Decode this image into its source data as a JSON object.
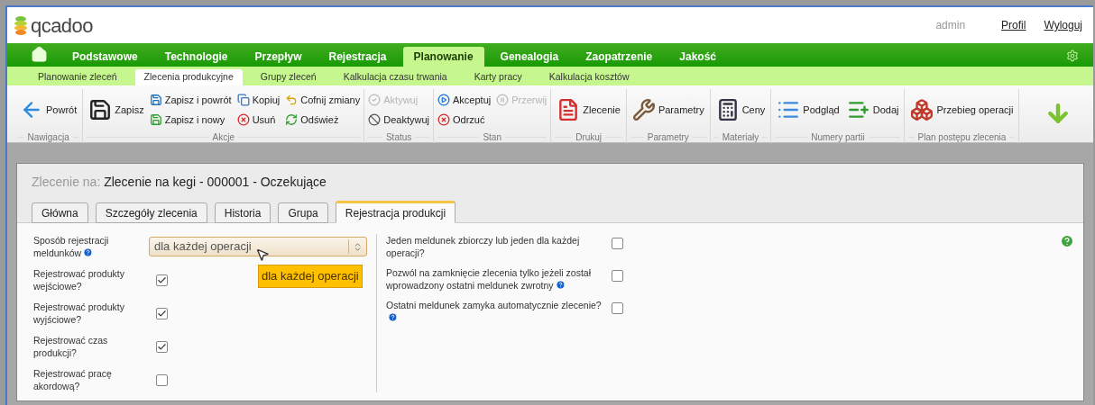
{
  "header": {
    "logo_text": "qcadoo",
    "user": "admin",
    "links": [
      "Profil",
      "Wyloguj"
    ]
  },
  "main_menu": [
    {
      "label": "Podstawowe",
      "selected": false
    },
    {
      "label": "Technologie",
      "selected": false
    },
    {
      "label": "Przepływ",
      "selected": false
    },
    {
      "label": "Rejestracja",
      "selected": false
    },
    {
      "label": "Planowanie",
      "selected": true
    },
    {
      "label": "Genealogia",
      "selected": false
    },
    {
      "label": "Zaopatrzenie",
      "selected": false
    },
    {
      "label": "Jakość",
      "selected": false
    }
  ],
  "sub_menu": [
    {
      "label": "Planowanie zleceń",
      "selected": false
    },
    {
      "label": "Zlecenia produkcyjne",
      "selected": true
    },
    {
      "label": "Grupy zleceń",
      "selected": false
    },
    {
      "label": "Kalkulacja czasu trwania",
      "selected": false
    },
    {
      "label": "Karty pracy",
      "selected": false
    },
    {
      "label": "Kalkulacja kosztów",
      "selected": false
    }
  ],
  "toolbar": [
    {
      "label": "Nawigacja",
      "buttons": [
        {
          "label": "Powrót",
          "kind": "large",
          "disabled": false
        }
      ]
    },
    {
      "label": "Akcje",
      "buttons": [
        {
          "label": "Zapisz",
          "kind": "large",
          "disabled": false
        },
        {
          "label": "Zapisz i powrót",
          "kind": "small",
          "disabled": false
        },
        {
          "label": "Zapisz i nowy",
          "kind": "small",
          "disabled": false
        },
        {
          "label": "Kopiuj",
          "kind": "small",
          "disabled": false
        },
        {
          "label": "Usuń",
          "kind": "small",
          "disabled": false
        },
        {
          "label": "Cofnij zmiany",
          "kind": "small",
          "disabled": false
        },
        {
          "label": "Odśwież",
          "kind": "small",
          "disabled": false
        }
      ]
    },
    {
      "label": "Status",
      "buttons": [
        {
          "label": "Aktywuj",
          "kind": "small",
          "disabled": true
        },
        {
          "label": "Deaktywuj",
          "kind": "small",
          "disabled": false
        }
      ]
    },
    {
      "label": "Stan",
      "buttons": [
        {
          "label": "Akceptuj",
          "kind": "small",
          "disabled": false
        },
        {
          "label": "Odrzuć",
          "kind": "small",
          "disabled": false
        },
        {
          "label": "Przerwij",
          "kind": "small",
          "disabled": true
        }
      ]
    },
    {
      "label": "Drukuj",
      "buttons": [
        {
          "label": "Zlecenie",
          "kind": "large",
          "disabled": false
        }
      ]
    },
    {
      "label": "Parametry",
      "buttons": [
        {
          "label": "Parametry",
          "kind": "large",
          "disabled": false
        }
      ]
    },
    {
      "label": "Materiały",
      "buttons": [
        {
          "label": "Ceny",
          "kind": "large",
          "disabled": false
        }
      ]
    },
    {
      "label": "Numery partii",
      "buttons": [
        {
          "label": "Podgląd",
          "kind": "large",
          "disabled": false
        },
        {
          "label": "Dodaj",
          "kind": "large",
          "disabled": false
        }
      ]
    },
    {
      "label": "Plan postępu zlecenia",
      "buttons": [
        {
          "label": "Przebieg operacji",
          "kind": "large",
          "disabled": false
        }
      ]
    }
  ],
  "form": {
    "title_prefix": "Zlecenie na:",
    "title": "Zlecenie na kegi - 000001 - Oczekujące",
    "tabs": [
      {
        "label": "Główna",
        "selected": false
      },
      {
        "label": "Szczegóły zlecenia",
        "selected": false
      },
      {
        "label": "Historia",
        "selected": false
      },
      {
        "label": "Grupa",
        "selected": false
      },
      {
        "label": "Rejestracja produkcji",
        "selected": true
      }
    ],
    "left_fields": [
      {
        "kind": "select",
        "label": "Sposób rejestracji meldunków",
        "help": true,
        "value": "dla każdej operacji"
      },
      {
        "kind": "checkbox",
        "label": "Rejestrować produkty wejściowe?",
        "checked": true
      },
      {
        "kind": "checkbox",
        "label": "Rejestrować produkty wyjściowe?",
        "checked": true
      },
      {
        "kind": "checkbox",
        "label": "Rejestrować czas produkcji?",
        "checked": true
      },
      {
        "kind": "checkbox",
        "label": "Rejestrować pracę akordową?",
        "checked": false
      }
    ],
    "tooltip": "dla każdej operacji",
    "right_fields": [
      {
        "kind": "checkbox",
        "label": "Jeden meldunek zbiorczy lub jeden dla każdej operacji?",
        "help": false,
        "checked": false
      },
      {
        "kind": "checkbox",
        "label": "Pozwól na zamknięcie zlecenia tylko jeżeli został wprowadzony ostatni meldunek zwrotny",
        "help": true,
        "checked": false
      },
      {
        "kind": "checkbox",
        "label": "Ostatni meldunek zamyka automatycznie zlecenie?",
        "help": true,
        "checked": false
      }
    ]
  }
}
